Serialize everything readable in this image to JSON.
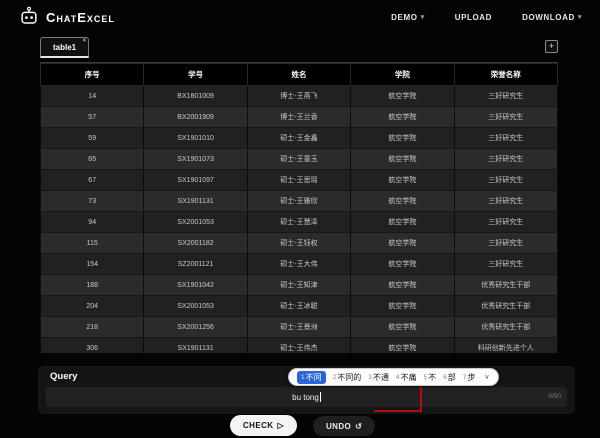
{
  "header": {
    "logo_text": "ChatExcel",
    "nav": [
      {
        "label": "DEMO",
        "chevron": true
      },
      {
        "label": "UPLOAD",
        "chevron": false
      },
      {
        "label": "DOWNLOAD",
        "chevron": true
      }
    ]
  },
  "tabs": {
    "active_label": "table1",
    "close_icon": "×",
    "add_icon": "+"
  },
  "table": {
    "columns": [
      "序号",
      "学号",
      "姓名",
      "学院",
      "荣誉名称"
    ],
    "rows": [
      [
        "14",
        "BX1801009",
        "博士-王燕飞",
        "航空学院",
        "三好研究生"
      ],
      [
        "57",
        "BX2001909",
        "博士-王兰香",
        "航空学院",
        "三好研究生"
      ],
      [
        "59",
        "SX1901010",
        "硕士-王金鑫",
        "航空学院",
        "三好研究生"
      ],
      [
        "65",
        "SX1901073",
        "硕士-王童玉",
        "航空学院",
        "三好研究生"
      ],
      [
        "67",
        "SX1901097",
        "硕士-王思瑶",
        "航空学院",
        "三好研究生"
      ],
      [
        "73",
        "SX1901131",
        "硕士-王雅欣",
        "航空学院",
        "三好研究生"
      ],
      [
        "94",
        "SX2001053",
        "硕士-王慧泽",
        "航空学院",
        "三好研究生"
      ],
      [
        "115",
        "SX2001182",
        "硕士-王钰权",
        "航空学院",
        "三好研究生"
      ],
      [
        "154",
        "SZ2001121",
        "硕士-王大伟",
        "航空学院",
        "三好研究生"
      ],
      [
        "188",
        "SX1901042",
        "硕士-王知津",
        "航空学院",
        "优秀研究生干部"
      ],
      [
        "204",
        "SX2001053",
        "硕士-王冰聪",
        "航空学院",
        "优秀研究生干部"
      ],
      [
        "218",
        "SX2001256",
        "硕士-王景洲",
        "航空学院",
        "优秀研究生干部"
      ],
      [
        "306",
        "SX1901131",
        "硕士-王伟杰",
        "航空学院",
        "科研创新先进个人"
      ]
    ]
  },
  "query": {
    "label": "Query",
    "input_value": "bu tong",
    "counter": "0/50",
    "ime": {
      "candidates": [
        {
          "num": "1",
          "text": "不同",
          "selected": true
        },
        {
          "num": "2",
          "text": "不同的",
          "selected": false
        },
        {
          "num": "3",
          "text": "不通",
          "selected": false
        },
        {
          "num": "4",
          "text": "不痛",
          "selected": false
        },
        {
          "num": "5",
          "text": "不",
          "selected": false
        },
        {
          "num": "6",
          "text": "部",
          "selected": false
        },
        {
          "num": "7",
          "text": "步",
          "selected": false
        }
      ],
      "chevron_icon": "∨"
    }
  },
  "actions": {
    "check_label": "CHECK",
    "check_icon": "▷",
    "undo_label": "UNDO",
    "undo_icon": "↺"
  },
  "colors": {
    "ime_selected_blue": "#2965d6",
    "annotation_red": "#b50d0d",
    "check_button_bg": "#f4f4f4"
  }
}
